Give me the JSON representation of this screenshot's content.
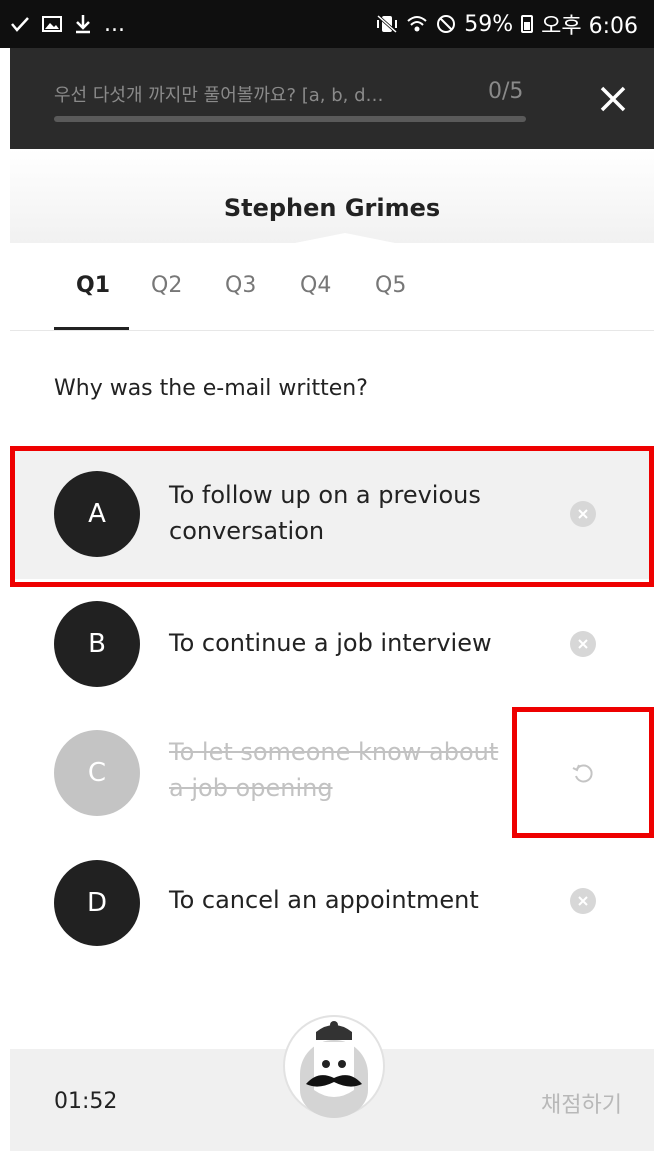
{
  "status_bar": {
    "left_icons": [
      "check-icon",
      "image-icon",
      "download-icon"
    ],
    "more": "...",
    "battery": "59%",
    "time": "오후 6:06"
  },
  "header": {
    "title": "우선 다섯개 까지만 풀어볼까요? [a, b, d…",
    "progress_text": "0/5",
    "progress": 0
  },
  "speaker": {
    "name": "Stephen Grimes"
  },
  "tabs": [
    {
      "label": "Q1",
      "active": true
    },
    {
      "label": "Q2",
      "active": false
    },
    {
      "label": "Q3",
      "active": false
    },
    {
      "label": "Q4",
      "active": false
    },
    {
      "label": "Q5",
      "active": false
    }
  ],
  "question": "Why was the e-mail written?",
  "options": [
    {
      "letter": "A",
      "line1": "To follow up on a previous",
      "line2": "conversation",
      "state": "selected",
      "action_icon": "remove-icon"
    },
    {
      "letter": "B",
      "line1": "To continue a job interview",
      "line2": "",
      "state": "normal",
      "action_icon": "remove-icon"
    },
    {
      "letter": "C",
      "line1": "To let someone know about",
      "line2": "a job opening",
      "state": "eliminated",
      "action_icon": "undo-icon"
    },
    {
      "letter": "D",
      "line1": "To cancel an appointment",
      "line2": "",
      "state": "normal",
      "action_icon": "remove-icon"
    }
  ],
  "footer": {
    "timer": "01:52",
    "submit_label": "채점하기"
  },
  "colors": {
    "highlight": "#ee0000",
    "header_bg": "#2b2b2b",
    "circle_dark": "#212121",
    "circle_dim": "#c4c4c4"
  }
}
